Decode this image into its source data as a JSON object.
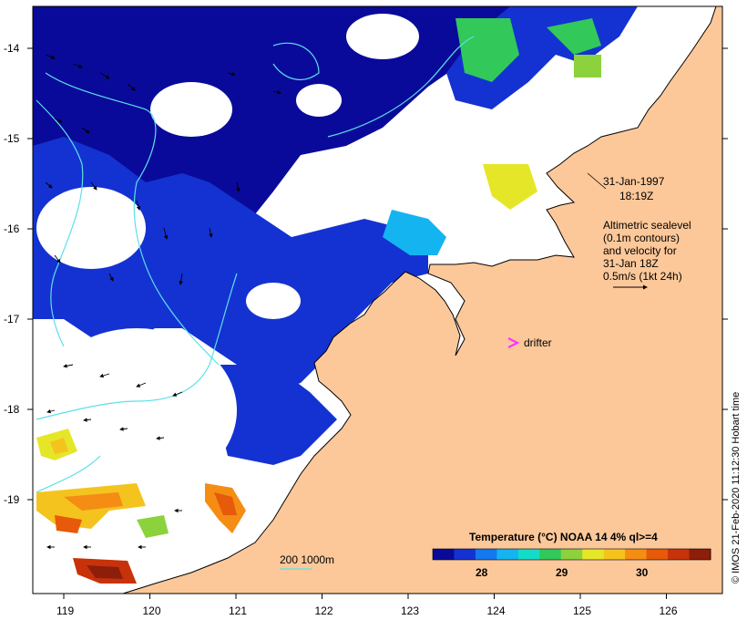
{
  "map": {
    "date": "31-Jan-1997",
    "time": "18:19Z",
    "altimetry_lines": [
      "Altimetric sealevel",
      "(0.1m contours)",
      "and velocity for",
      "31-Jan 18Z",
      "0.5m/s (1kt 24h)"
    ],
    "drifter_label": "drifter",
    "depth_scale_label": "200  1000m",
    "colorbar": {
      "title": "Temperature (°C) NOAA 14 4% ql>=4",
      "ticks": [
        "28",
        "29",
        "30"
      ],
      "colors": [
        "#0a0a9a",
        "#1432d2",
        "#1478f0",
        "#14b4f0",
        "#14dcc8",
        "#32c85a",
        "#8cd23c",
        "#e6e628",
        "#f5c31e",
        "#f58c14",
        "#e65a0a",
        "#c8320a",
        "#8c1e0a"
      ]
    },
    "x_axis_ticks": [
      "119",
      "120",
      "121",
      "122",
      "123",
      "124",
      "125",
      "126"
    ],
    "y_axis_ticks": [
      "-14",
      "-15",
      "-16",
      "-17",
      "-18",
      "-19"
    ],
    "credit": "© IMOS 21-Feb-2020 11:12:30 Hobart time",
    "colors": {
      "land": "#fcc89a",
      "ocean_cloud": "#ffffff",
      "contour": "#5ce0e8",
      "drifter": "#ff33ff"
    }
  }
}
